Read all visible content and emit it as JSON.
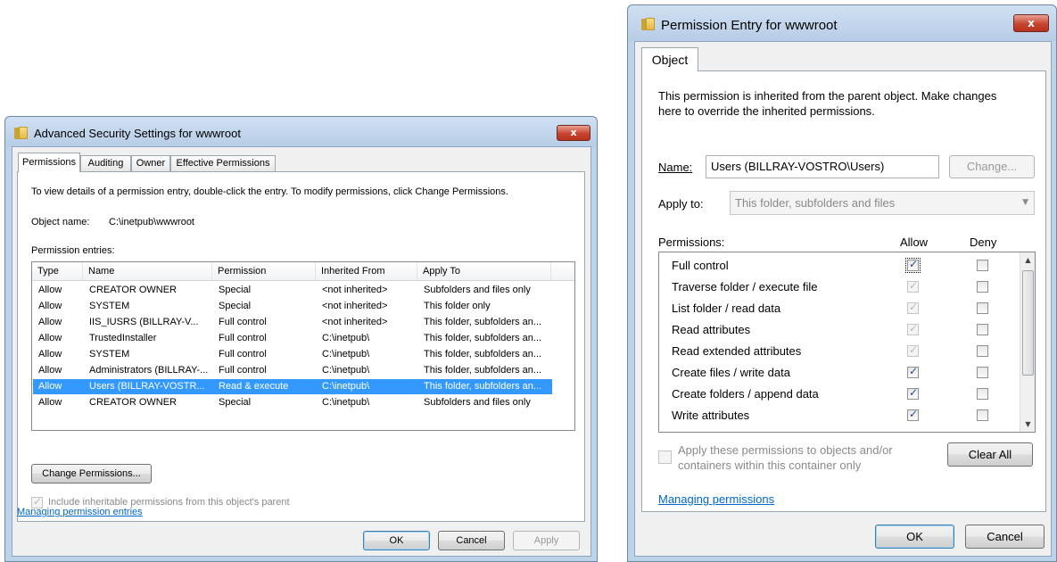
{
  "left_dialog": {
    "title": "Advanced Security Settings for wwwroot",
    "close_label": "x",
    "tabs": [
      "Permissions",
      "Auditing",
      "Owner",
      "Effective Permissions"
    ],
    "instructions": "To view details of a permission entry, double-click the entry. To modify permissions, click Change Permissions.",
    "object_name_label": "Object name:",
    "object_name_value": "C:\\inetpub\\wwwroot",
    "entries_label": "Permission entries:",
    "columns": [
      "Type",
      "Name",
      "Permission",
      "Inherited From",
      "Apply To"
    ],
    "rows": [
      {
        "type": "Allow",
        "name": "CREATOR OWNER",
        "permission": "Special",
        "inherited_from": "<not inherited>",
        "apply_to": "Subfolders and files only"
      },
      {
        "type": "Allow",
        "name": "SYSTEM",
        "permission": "Special",
        "inherited_from": "<not inherited>",
        "apply_to": "This folder only"
      },
      {
        "type": "Allow",
        "name": "IIS_IUSRS (BILLRAY-V...",
        "permission": "Full control",
        "inherited_from": "<not inherited>",
        "apply_to": "This folder, subfolders an..."
      },
      {
        "type": "Allow",
        "name": "TrustedInstaller",
        "permission": "Full control",
        "inherited_from": "C:\\inetpub\\",
        "apply_to": "This folder, subfolders an..."
      },
      {
        "type": "Allow",
        "name": "SYSTEM",
        "permission": "Full control",
        "inherited_from": "C:\\inetpub\\",
        "apply_to": "This folder, subfolders an..."
      },
      {
        "type": "Allow",
        "name": "Administrators (BILLRAY-...",
        "permission": "Full control",
        "inherited_from": "C:\\inetpub\\",
        "apply_to": "This folder, subfolders an..."
      },
      {
        "type": "Allow",
        "name": "Users (BILLRAY-VOSTR...",
        "permission": "Read & execute",
        "inherited_from": "C:\\inetpub\\",
        "apply_to": "This folder, subfolders an...",
        "selected": true
      },
      {
        "type": "Allow",
        "name": "CREATOR OWNER",
        "permission": "Special",
        "inherited_from": "C:\\inetpub\\",
        "apply_to": "Subfolders and files only"
      }
    ],
    "change_permissions_button": "Change Permissions...",
    "include_inheritable_label": "Include inheritable permissions from this object's parent",
    "include_inheritable_checked": true,
    "managing_link": "Managing permission entries",
    "ok_button": "OK",
    "cancel_button": "Cancel",
    "apply_button": "Apply"
  },
  "right_dialog": {
    "title": "Permission Entry for wwwroot",
    "close_label": "x",
    "tab": "Object",
    "info_text_line1": "This permission is inherited from the parent object. Make changes",
    "info_text_line2": "here to override the inherited permissions.",
    "name_label": "Name:",
    "name_value": "Users (BILLRAY-VOSTRO\\Users)",
    "change_button": "Change...",
    "apply_to_label": "Apply to:",
    "apply_to_value": "This folder, subfolders and files",
    "permissions_label": "Permissions:",
    "allow_header": "Allow",
    "deny_header": "Deny",
    "permissions": [
      {
        "name": "Full control",
        "allow": true,
        "allow_disabled": false,
        "deny": false
      },
      {
        "name": "Traverse folder / execute file",
        "allow": true,
        "allow_disabled": true,
        "deny": false
      },
      {
        "name": "List folder / read data",
        "allow": true,
        "allow_disabled": true,
        "deny": false
      },
      {
        "name": "Read attributes",
        "allow": true,
        "allow_disabled": true,
        "deny": false
      },
      {
        "name": "Read extended attributes",
        "allow": true,
        "allow_disabled": true,
        "deny": false
      },
      {
        "name": "Create files / write data",
        "allow": true,
        "allow_disabled": false,
        "deny": false
      },
      {
        "name": "Create folders / append data",
        "allow": true,
        "allow_disabled": false,
        "deny": false
      },
      {
        "name": "Write attributes",
        "allow": true,
        "allow_disabled": false,
        "deny": false
      }
    ],
    "apply_these_line1": "Apply these permissions to objects and/or",
    "apply_these_line2": "containers within this container only",
    "clear_all_button": "Clear All",
    "managing_link": "Managing permissions",
    "ok_button": "OK",
    "cancel_button": "Cancel"
  }
}
